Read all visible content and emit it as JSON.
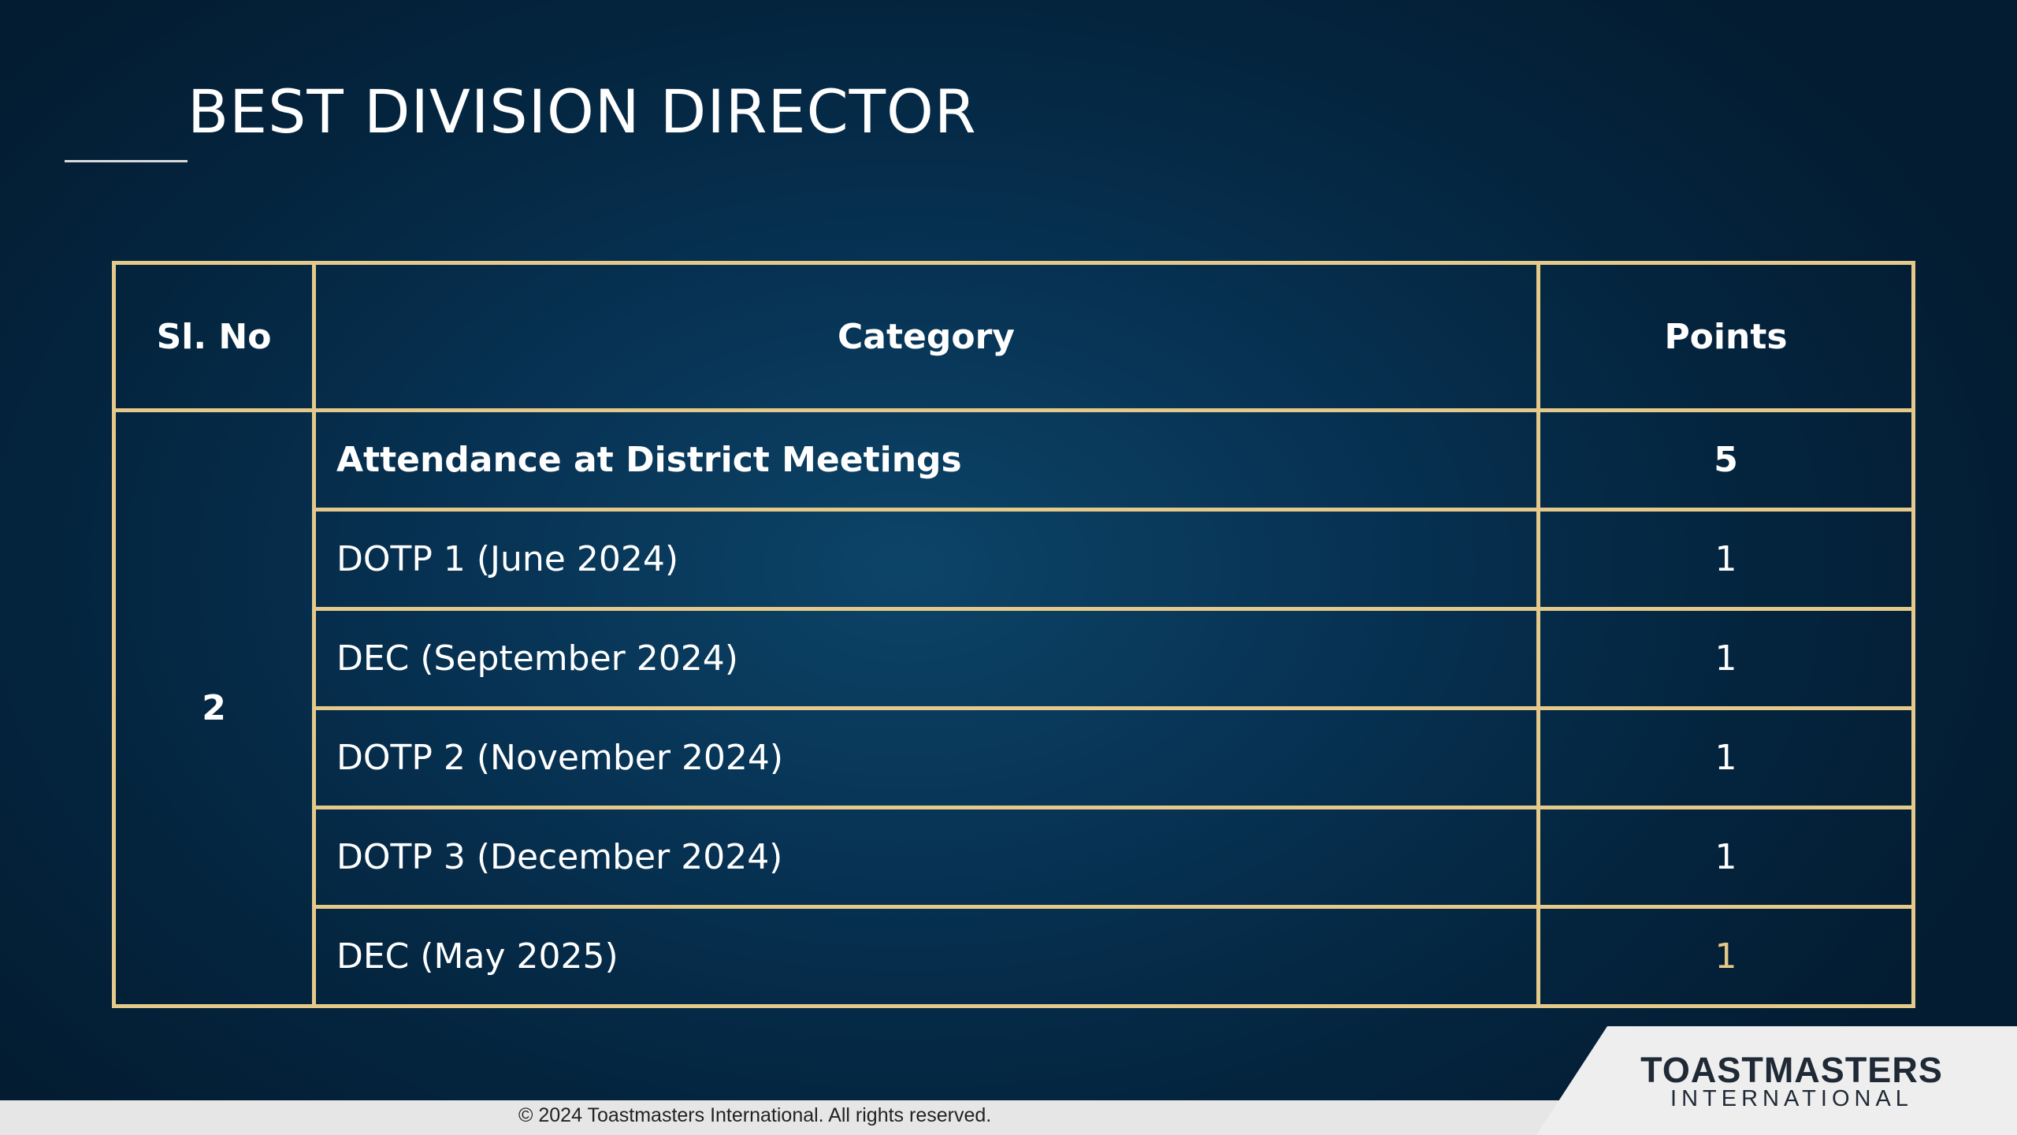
{
  "slide": {
    "title": "BEST DIVISION DIRECTOR"
  },
  "table": {
    "headers": {
      "sl_no": "Sl. No",
      "category": "Category",
      "points": "Points"
    },
    "sl_value": "2",
    "rows": [
      {
        "category": "Attendance at District Meetings",
        "points": "5"
      },
      {
        "category": "DOTP 1 (June 2024)",
        "points": "1"
      },
      {
        "category": "DEC (September 2024)",
        "points": "1"
      },
      {
        "category": "DOTP 2 (November 2024)",
        "points": "1"
      },
      {
        "category": "DOTP 3 (December 2024)",
        "points": "1"
      },
      {
        "category": "DEC (May 2025)",
        "points": "1"
      }
    ]
  },
  "footer": {
    "copyright": "© 2024 Toastmasters International. All rights reserved.",
    "logo_main": "TOASTMASTERS",
    "logo_sub": "INTERNATIONAL"
  },
  "colors": {
    "background": "#073253",
    "border_gold": "#e4c98a",
    "footer_gray": "#e6e6e6"
  }
}
